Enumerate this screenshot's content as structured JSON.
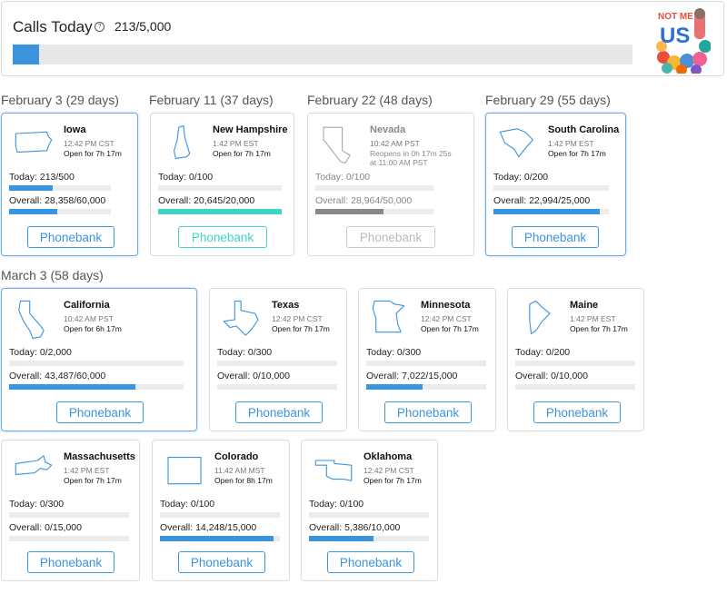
{
  "header": {
    "title": "Calls Today",
    "info_icon": "info-icon",
    "count": "213/5,000",
    "progress": 0.0426,
    "logo": {
      "line1": "NOT ME",
      "line2": "US"
    }
  },
  "sections": [
    {
      "heading": "February 3 (29 days)"
    },
    {
      "heading": "February 11 (37 days)"
    },
    {
      "heading": "February 22 (48 days)"
    },
    {
      "heading": "February 29 (55 days)"
    },
    {
      "heading": "March 3 (58 days)"
    }
  ],
  "states": [
    {
      "name": "Iowa",
      "time": "12:42 PM CST",
      "open": "Open for 7h 17m",
      "today": "Today: 213/500",
      "today_pct": 0.426,
      "overall": "Overall: 28,358/60,000",
      "overall_pct": 0.4726,
      "button": "Phonebank",
      "status": "open",
      "highlight": true,
      "bar_color": "#3b94de",
      "shape_icon": "iowa-outline-icon"
    },
    {
      "name": "New Hampshire",
      "time": "1:42 PM EST",
      "open": "Open for 7h 17m",
      "today": "Today: 0/100",
      "today_pct": 0,
      "overall": "Overall: 20,645/20,000",
      "overall_pct": 1.0,
      "button": "Phonebank",
      "status": "complete",
      "highlight": false,
      "bar_color": "#3dd6c6",
      "shape_icon": "new-hampshire-outline-icon"
    },
    {
      "name": "Nevada",
      "time": "10:42 AM PST",
      "open": "Reopens in 0h 17m 25s",
      "open2": "at 11:00 AM PST",
      "today": "Today: 0/100",
      "today_pct": 0,
      "overall": "Overall: 28,964/50,000",
      "overall_pct": 0.5793,
      "button": "Phonebank",
      "status": "closed",
      "highlight": false,
      "bar_color": "#888888",
      "shape_icon": "nevada-outline-icon"
    },
    {
      "name": "South Carolina",
      "time": "1:42 PM EST",
      "open": "Open for 7h 17m",
      "today": "Today: 0/200",
      "today_pct": 0,
      "overall": "Overall: 22,994/25,000",
      "overall_pct": 0.9198,
      "button": "Phonebank",
      "status": "open",
      "highlight": true,
      "bar_color": "#3b94de",
      "shape_icon": "south-carolina-outline-icon"
    },
    {
      "name": "California",
      "time": "10:42 AM PST",
      "open": "Open for 6h 17m",
      "today": "Today: 0/2,000",
      "today_pct": 0,
      "overall": "Overall: 43,487/60,000",
      "overall_pct": 0.7248,
      "button": "Phonebank",
      "status": "open",
      "highlight": true,
      "bar_color": "#3b94de",
      "shape_icon": "california-outline-icon"
    },
    {
      "name": "Texas",
      "time": "12:42 PM CST",
      "open": "Open for 7h 17m",
      "today": "Today: 0/300",
      "today_pct": 0,
      "overall": "Overall: 0/10,000",
      "overall_pct": 0,
      "button": "Phonebank",
      "status": "open",
      "highlight": false,
      "bar_color": "#3b94de",
      "shape_icon": "texas-outline-icon"
    },
    {
      "name": "Minnesota",
      "time": "12:42 PM CST",
      "open": "Open for 7h 17m",
      "today": "Today: 0/300",
      "today_pct": 0,
      "overall": "Overall: 7,022/15,000",
      "overall_pct": 0.4681,
      "button": "Phonebank",
      "status": "open",
      "highlight": false,
      "bar_color": "#3b94de",
      "shape_icon": "minnesota-outline-icon"
    },
    {
      "name": "Maine",
      "time": "1:42 PM EST",
      "open": "Open for 7h 17m",
      "today": "Today: 0/200",
      "today_pct": 0,
      "overall": "Overall: 0/10,000",
      "overall_pct": 0,
      "button": "Phonebank",
      "status": "open",
      "highlight": false,
      "bar_color": "#3b94de",
      "shape_icon": "maine-outline-icon"
    },
    {
      "name": "Massachusetts",
      "time": "1:42 PM EST",
      "open": "Open for 7h 17m",
      "today": "Today: 0/300",
      "today_pct": 0,
      "overall": "Overall: 0/15,000",
      "overall_pct": 0,
      "button": "Phonebank",
      "status": "open",
      "highlight": false,
      "bar_color": "#3b94de",
      "shape_icon": "massachusetts-outline-icon"
    },
    {
      "name": "Colorado",
      "time": "11:42 AM MST",
      "open": "Open for 8h 17m",
      "today": "Today: 0/100",
      "today_pct": 0,
      "overall": "Overall: 14,248/15,000",
      "overall_pct": 0.9499,
      "button": "Phonebank",
      "status": "open",
      "highlight": false,
      "bar_color": "#3b94de",
      "shape_icon": "colorado-outline-icon"
    },
    {
      "name": "Oklahoma",
      "time": "12:42 PM CST",
      "open": "Open for 7h 17m",
      "today": "Today: 0/100",
      "today_pct": 0,
      "overall": "Overall: 5,386/10,000",
      "overall_pct": 0.5386,
      "button": "Phonebank",
      "status": "open",
      "highlight": false,
      "bar_color": "#3b94de",
      "shape_icon": "oklahoma-outline-icon"
    }
  ]
}
